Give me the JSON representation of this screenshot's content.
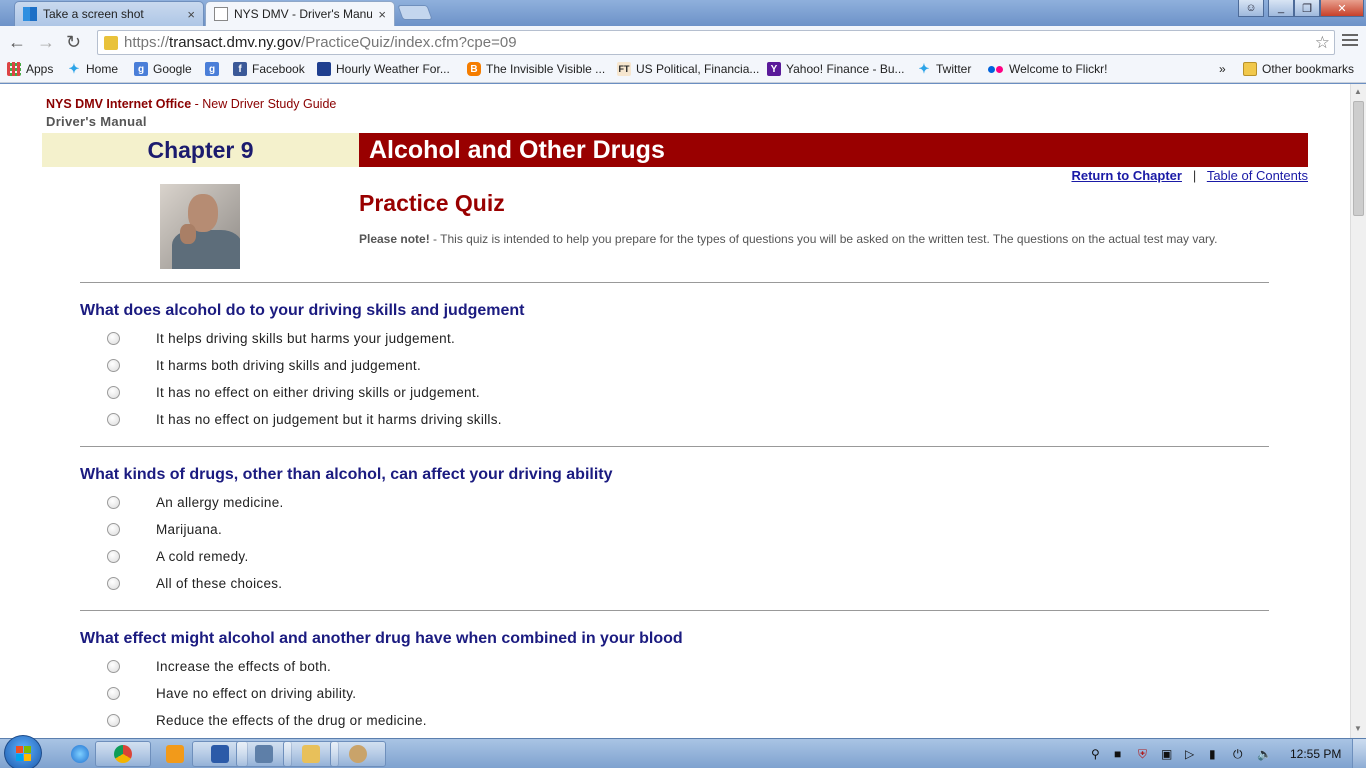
{
  "browser": {
    "tabs": [
      {
        "title": "Take a screen shot",
        "active": false,
        "icon": "windows-icon"
      },
      {
        "title": "NYS DMV - Driver's Manu",
        "active": true,
        "icon": "page-icon"
      }
    ],
    "url": {
      "scheme": "https://",
      "host": "transact.dmv.ny.gov",
      "path": "/PracticeQuiz/index.cfm?cpe=09"
    },
    "bookmarks": [
      {
        "label": "Apps",
        "icon": "apps-grid-icon"
      },
      {
        "label": "Home",
        "icon": "twitter-bird-icon"
      },
      {
        "label": "Google",
        "icon": "google-icon"
      },
      {
        "label": "",
        "icon": "google-icon"
      },
      {
        "label": "Facebook",
        "icon": "facebook-icon"
      },
      {
        "label": "Hourly Weather For...",
        "icon": "weather-channel-icon"
      },
      {
        "label": "The Invisible Visible ...",
        "icon": "blogger-icon"
      },
      {
        "label": "US Political, Financia...",
        "icon": "ft-icon"
      },
      {
        "label": "Yahoo! Finance - Bu...",
        "icon": "yahoo-icon"
      },
      {
        "label": "Twitter",
        "icon": "twitter-bird-icon"
      },
      {
        "label": "Welcome to Flickr!",
        "icon": "flickr-icon"
      }
    ],
    "bookmarks_overflow": "»",
    "other_bookmarks": "Other bookmarks"
  },
  "page": {
    "header": {
      "office": "NYS DMV Internet Office",
      "separator": " - ",
      "guide": "New Driver Study Guide",
      "manual": "Driver's Manual"
    },
    "chapter": "Chapter 9",
    "chapter_title": "Alcohol and Other Drugs",
    "links": {
      "return": "Return to Chapter",
      "divider": "|",
      "toc": "Table of Contents"
    },
    "quiz_title": "Practice Quiz",
    "note_label": "Please note!",
    "note_text": " - This quiz is intended to help you prepare for the types of questions you will be asked on the written test. The questions on the actual test may vary.",
    "questions": [
      {
        "text": "What does alcohol do to your driving skills and judgement",
        "options": [
          "It helps driving skills but harms your judgement.",
          "It harms both driving skills and judgement.",
          "It has no effect on either driving skills or judgement.",
          "It has no effect on judgement but it harms driving skills."
        ]
      },
      {
        "text": "What kinds of drugs, other than alcohol, can affect your driving ability",
        "options": [
          "An allergy medicine.",
          "Marijuana.",
          "A cold remedy.",
          "All of these choices."
        ]
      },
      {
        "text": "What effect might alcohol and another drug have when combined in your blood",
        "options": [
          "Increase the effects of both.",
          "Have no effect on driving ability.",
          "Reduce the effects of the drug or medicine."
        ]
      }
    ]
  },
  "taskbar": {
    "clock": "12:55 PM",
    "apps": [
      "internet-explorer-icon",
      "chrome-icon",
      "media-player-icon",
      "word-icon",
      "remote-desktop-icon",
      "file-explorer-icon",
      "paint-icon"
    ]
  }
}
